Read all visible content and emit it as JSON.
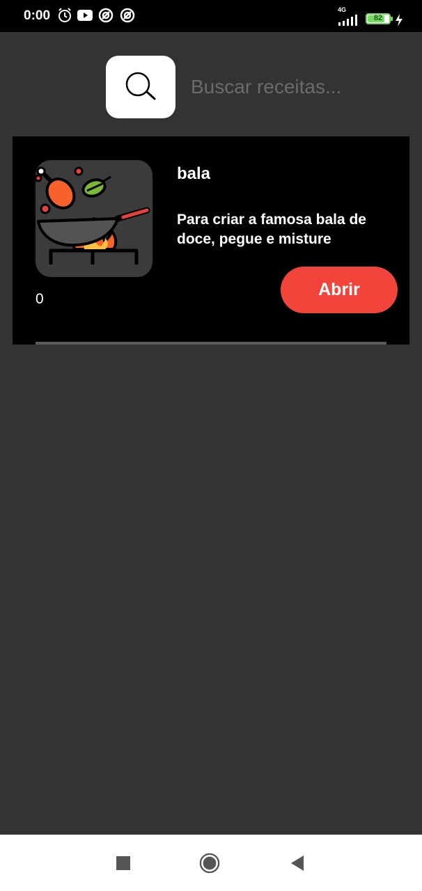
{
  "status_bar": {
    "time": "0:00",
    "network": "4G",
    "battery": "82",
    "battery_level": 0.82,
    "icons": [
      "alarm-icon",
      "youtube-icon",
      "sync-icon",
      "sync-icon",
      "signal-icon",
      "battery-icon",
      "charging-icon"
    ]
  },
  "search": {
    "placeholder": "Buscar receitas...",
    "icon": "search-icon"
  },
  "recipes": [
    {
      "title": "bala",
      "description": "Para criar a famosa bala de doce, pegue e misture",
      "count": "0",
      "open_label": "Abrir",
      "image": "wok-cooking-icon"
    }
  ],
  "nav": {
    "icons": [
      "recents-square-icon",
      "home-circle-icon",
      "back-triangle-icon"
    ]
  },
  "colors": {
    "background": "#333333",
    "card": "#000000",
    "accent": "#f1443b",
    "search_button": "#ffffff"
  }
}
